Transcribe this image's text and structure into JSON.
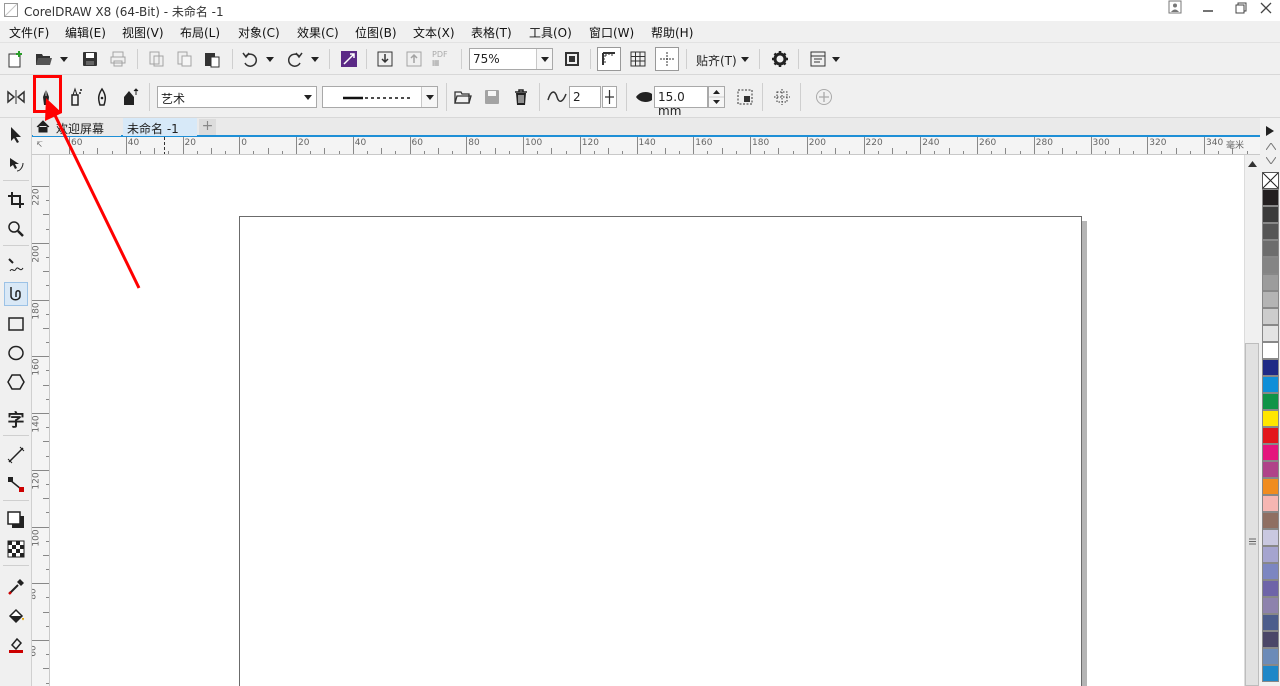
{
  "window": {
    "title": "CorelDRAW X8 (64-Bit) - 未命名 -1"
  },
  "menu": [
    "文件(F)",
    "编辑(E)",
    "视图(V)",
    "布局(L)",
    "对象(C)",
    "效果(C)",
    "位图(B)",
    "文本(X)",
    "表格(T)",
    "工具(O)",
    "窗口(W)",
    "帮助(H)"
  ],
  "standard_toolbar": {
    "zoom_value": "75%",
    "snap_label": "贴齐(T)",
    "pdf_label": "PDF"
  },
  "property_bar": {
    "preset_value": "艺术",
    "smoothing_value": "2",
    "width_value": "15.0 mm"
  },
  "tabs": {
    "welcome": "欢迎屏幕",
    "document": "未命名 -1"
  },
  "rulers": {
    "unit_label": "毫米",
    "horizontal_labels": [
      "60",
      "40",
      "20",
      "0",
      "20",
      "40",
      "60",
      "80",
      "100",
      "120",
      "140",
      "160",
      "180",
      "200",
      "220",
      "240",
      "260",
      "280",
      "300",
      "320",
      "340"
    ],
    "vertical_labels": [
      "220",
      "200",
      "180",
      "160",
      "140",
      "120",
      "100",
      "80",
      "60"
    ]
  },
  "palette": {
    "colors": [
      "#231f20",
      "#3b3b3b",
      "#555555",
      "#6d6d6d",
      "#858585",
      "#9c9c9c",
      "#b4b4b4",
      "#cccccc",
      "#e3e3e3",
      "#ffffff",
      "#1f2a86",
      "#0e8fd8",
      "#109448",
      "#ffe600",
      "#e3161b",
      "#e4157d",
      "#b04289",
      "#f08c1f",
      "#f6b6b2",
      "#8f6f62",
      "#c9c8e0",
      "#a5a4cf",
      "#7c86c1",
      "#6e64a8",
      "#8d82ad",
      "#4c5d8c",
      "#4b4668",
      "#6c8bb8",
      "#1e87c8"
    ]
  }
}
